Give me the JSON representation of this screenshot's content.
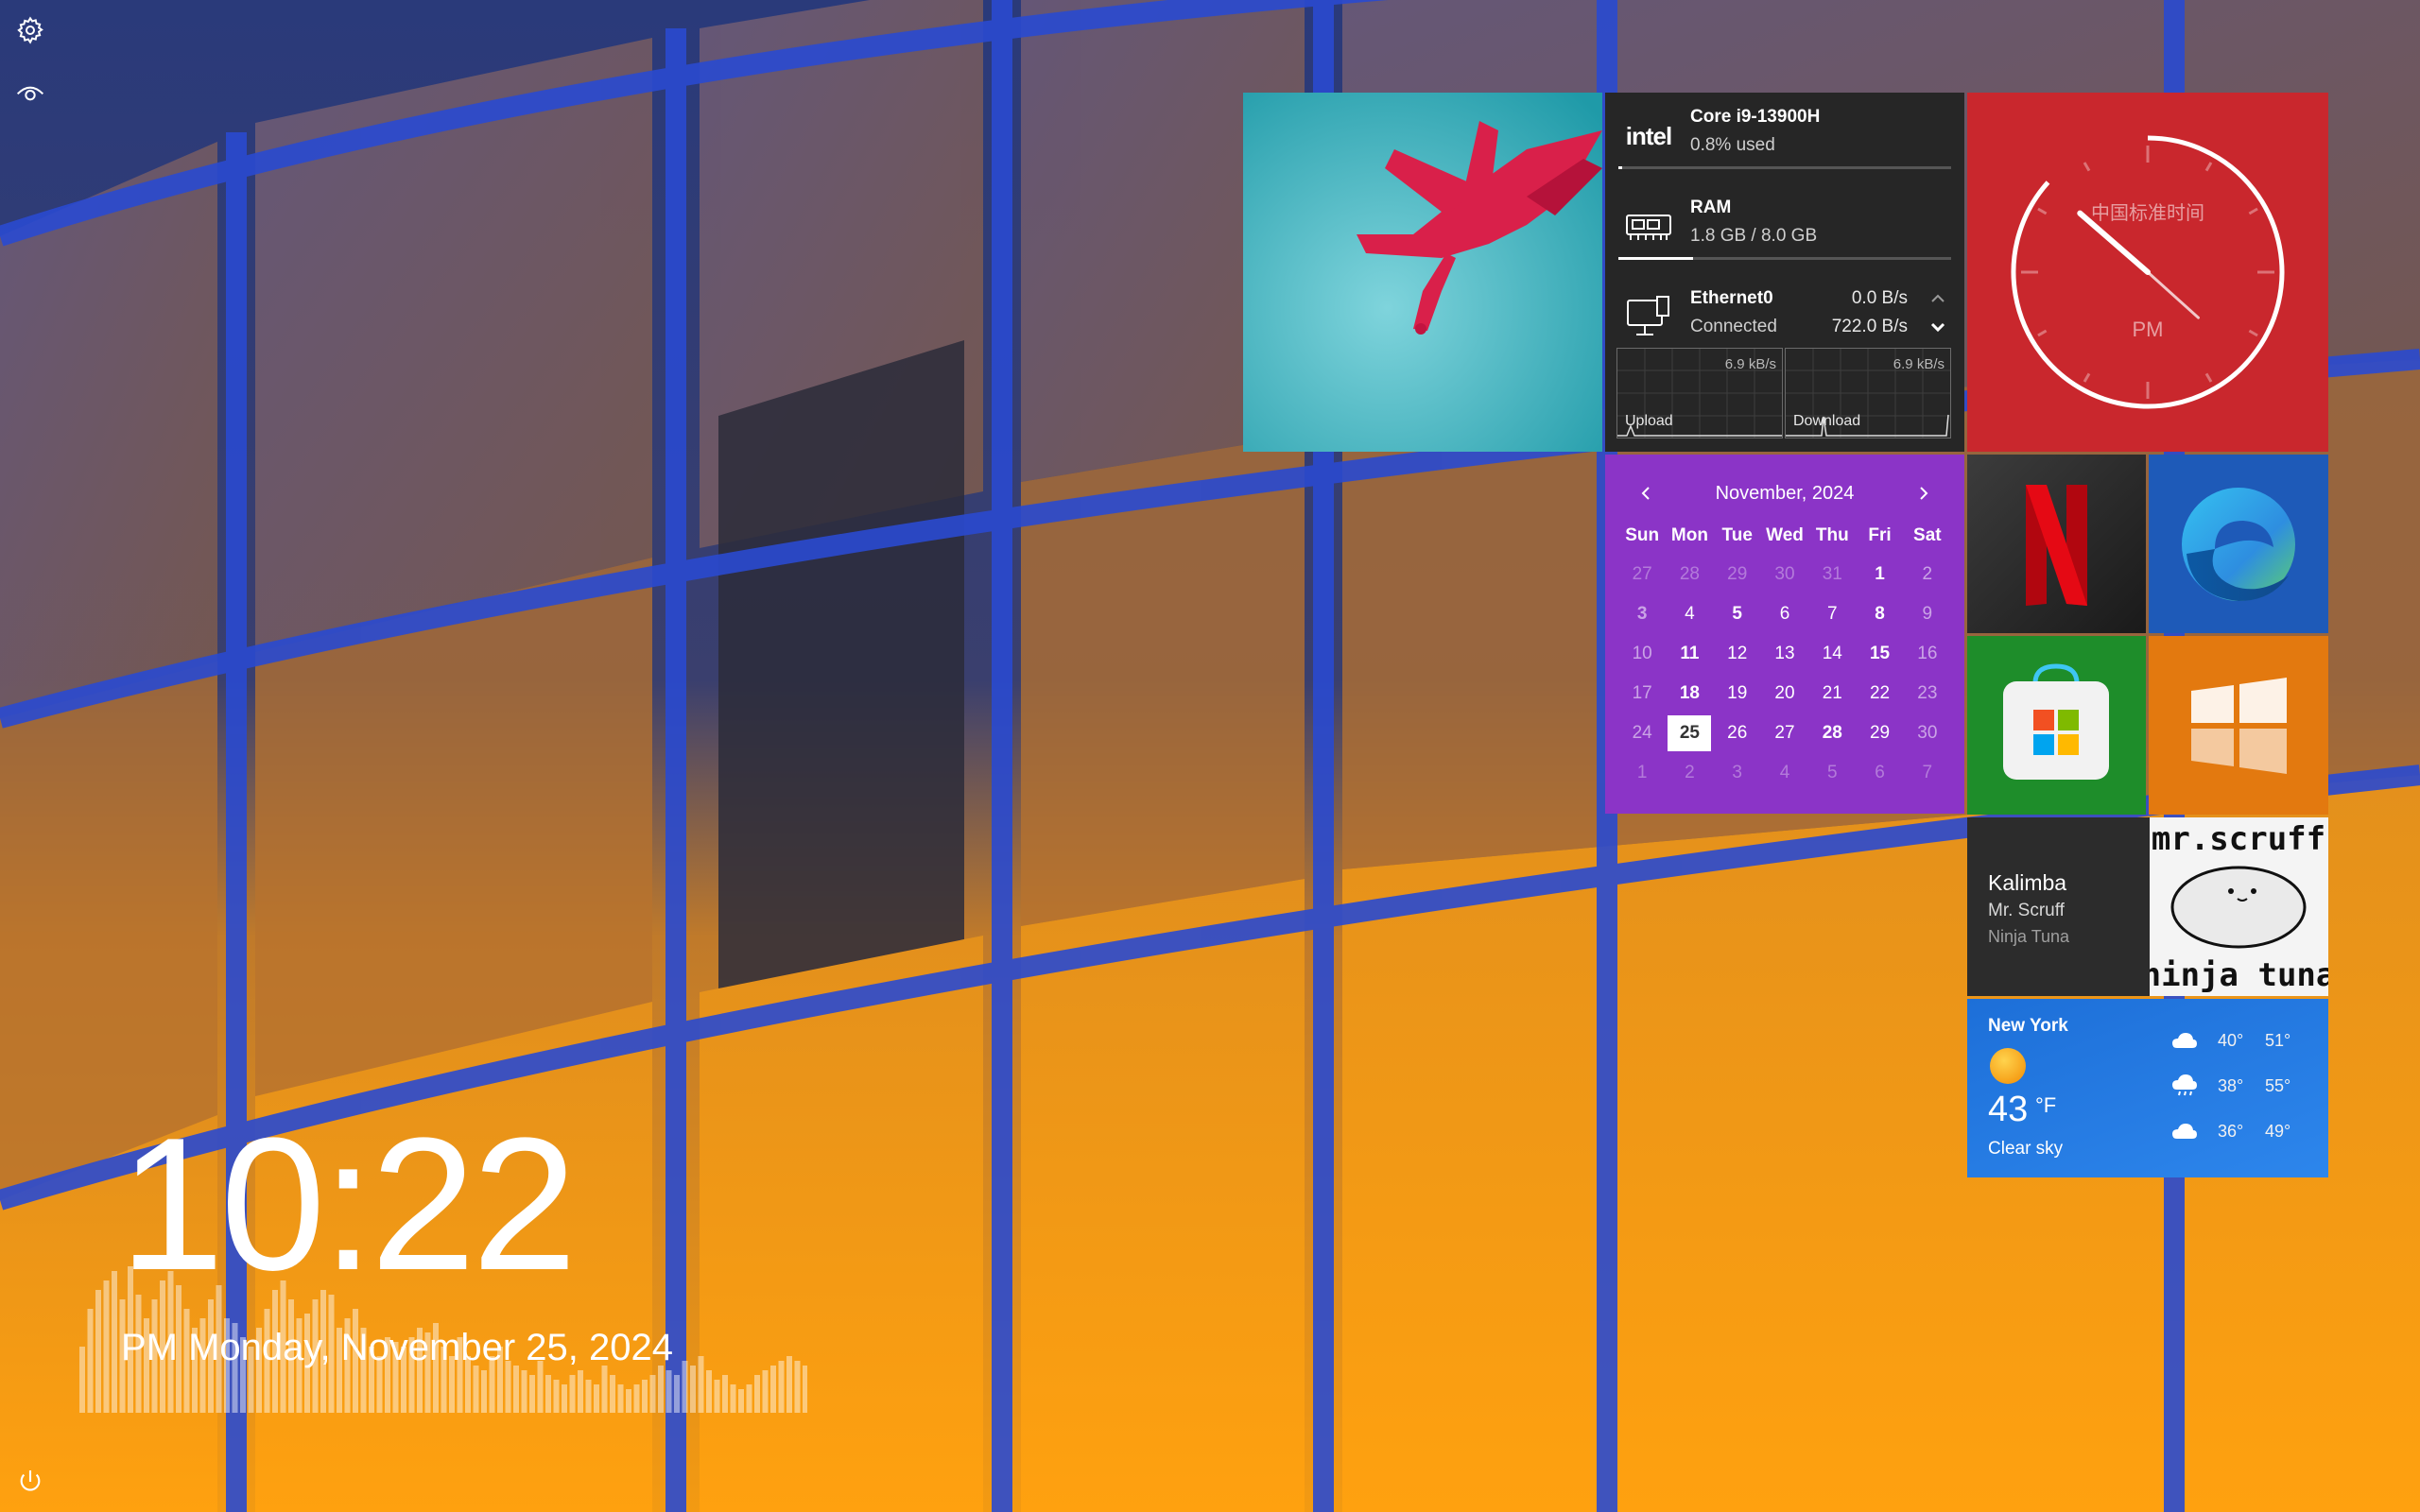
{
  "clock": {
    "time": "10:22",
    "date_line": "PM Monday, November 25, 2024"
  },
  "rail": {
    "settings_icon": "gear-icon",
    "visibility_icon": "eye-icon",
    "power_icon": "power-icon"
  },
  "system": {
    "cpu": {
      "brand": "intel",
      "name": "Core i9-13900H",
      "usage": "0.8% used",
      "usage_fraction": 0.008
    },
    "ram": {
      "label": "RAM",
      "usage": "1.8 GB / 8.0 GB",
      "usage_fraction": 0.225
    },
    "network": {
      "name": "Ethernet0",
      "status": "Connected",
      "upload_rate": "0.0 B/s",
      "download_rate": "722.0 B/s",
      "upload_scale": "6.9 kB/s",
      "download_scale": "6.9 kB/s",
      "upload_label": "Upload",
      "download_label": "Download"
    }
  },
  "analog_clock": {
    "zone_label": "中国标准时间",
    "ampm": "PM",
    "hour": 10,
    "minute": 22,
    "accent": "#c9272d"
  },
  "calendar": {
    "title": "November, 2024",
    "weekdays": [
      "Sun",
      "Mon",
      "Tue",
      "Wed",
      "Thu",
      "Fri",
      "Sat"
    ],
    "weeks": [
      [
        "27",
        "28",
        "29",
        "30",
        "31",
        "1",
        "2"
      ],
      [
        "3",
        "4",
        "5",
        "6",
        "7",
        "8",
        "9"
      ],
      [
        "10",
        "11",
        "12",
        "13",
        "14",
        "15",
        "16"
      ],
      [
        "17",
        "18",
        "19",
        "20",
        "21",
        "22",
        "23"
      ],
      [
        "24",
        "25",
        "26",
        "27",
        "28",
        "29",
        "30"
      ],
      [
        "1",
        "2",
        "3",
        "4",
        "5",
        "6",
        "7"
      ]
    ],
    "today": "25",
    "accent": "#8b34c7"
  },
  "apps": {
    "netflix": "netflix-icon",
    "edge": "edge-icon",
    "store": "microsoft-store-icon",
    "windows": "windows-logo-icon"
  },
  "music": {
    "title": "Kalimba",
    "artist": "Mr. Scruff",
    "album": "Ninja Tuna",
    "art_text_top": "mr.scruff",
    "art_text_bottom": "ninja tuna"
  },
  "weather": {
    "city": "New York",
    "temperature": "43",
    "unit": "°F",
    "condition": "Clear sky",
    "forecast": [
      {
        "icon": "cloud-icon",
        "low": "40°",
        "high": "51°"
      },
      {
        "icon": "rain-cloud-icon",
        "low": "38°",
        "high": "55°"
      },
      {
        "icon": "cloud-icon",
        "low": "36°",
        "high": "49°"
      }
    ]
  }
}
